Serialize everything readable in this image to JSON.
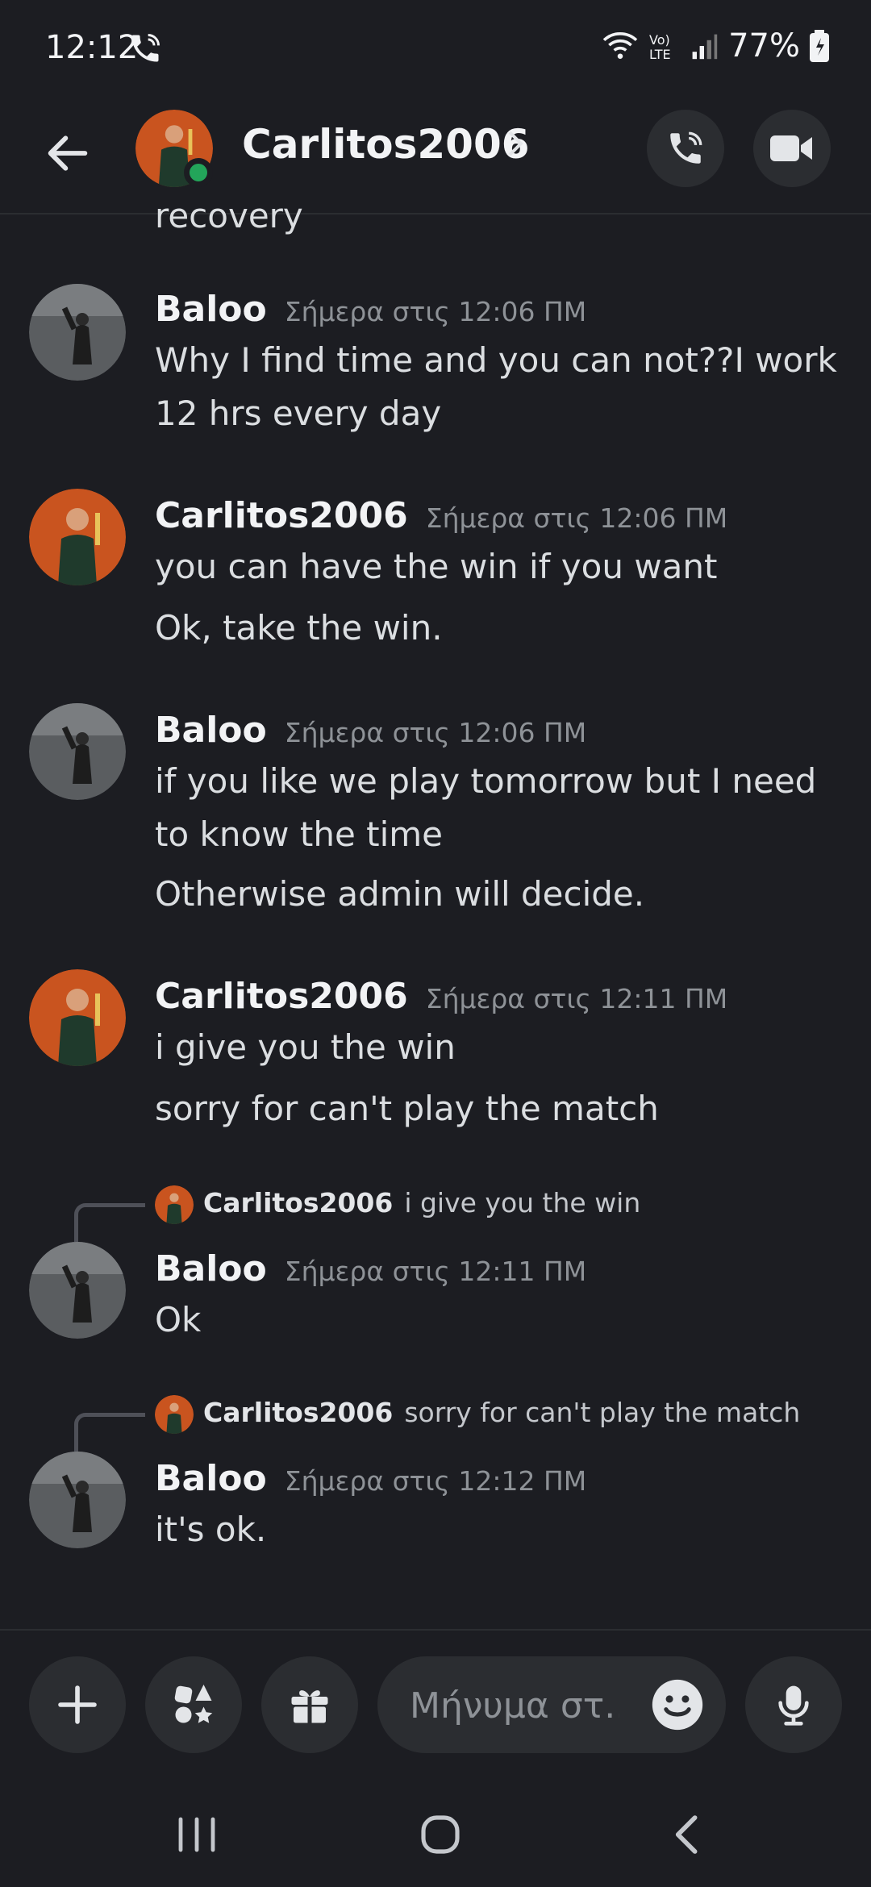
{
  "status_bar": {
    "time": "12:12",
    "battery": "77%"
  },
  "header": {
    "name": "Carlitos2006"
  },
  "cutoff_text": "recovery",
  "messages": [
    {
      "author": "Baloo",
      "timestamp": "Σήμερα στις 12:06 ΠΜ",
      "lines": [
        "Why I find time and you can not??I work",
        "12 hrs every day"
      ]
    },
    {
      "author": "Carlitos2006",
      "timestamp": "Σήμερα στις 12:06 ΠΜ",
      "lines": [
        "you can have the win if you want",
        "Ok, take the win."
      ]
    },
    {
      "author": "Baloo",
      "timestamp": "Σήμερα στις 12:06 ΠΜ",
      "lines": [
        "if you like we play tomorrow but I need",
        "to know the time",
        "Otherwise admin will decide."
      ]
    },
    {
      "author": "Carlitos2006",
      "timestamp": "Σήμερα στις 12:11 ΠΜ",
      "lines": [
        "i give you the win",
        "sorry for can't play the match"
      ]
    },
    {
      "reply_to": {
        "author": "Carlitos2006",
        "text": "i give you the win"
      },
      "author": "Baloo",
      "timestamp": "Σήμερα στις 12:11 ΠΜ",
      "lines": [
        "Ok"
      ]
    },
    {
      "reply_to": {
        "author": "Carlitos2006",
        "text": "sorry for can't play the match"
      },
      "author": "Baloo",
      "timestamp": "Σήμερα στις 12:12 ΠΜ",
      "lines": [
        "it's ok."
      ]
    }
  ],
  "composer": {
    "placeholder": "Μήνυμα στ..."
  },
  "colors": {
    "background": "#1c1d22",
    "online": "#23a55a",
    "button_bg": "#2b2d31"
  }
}
